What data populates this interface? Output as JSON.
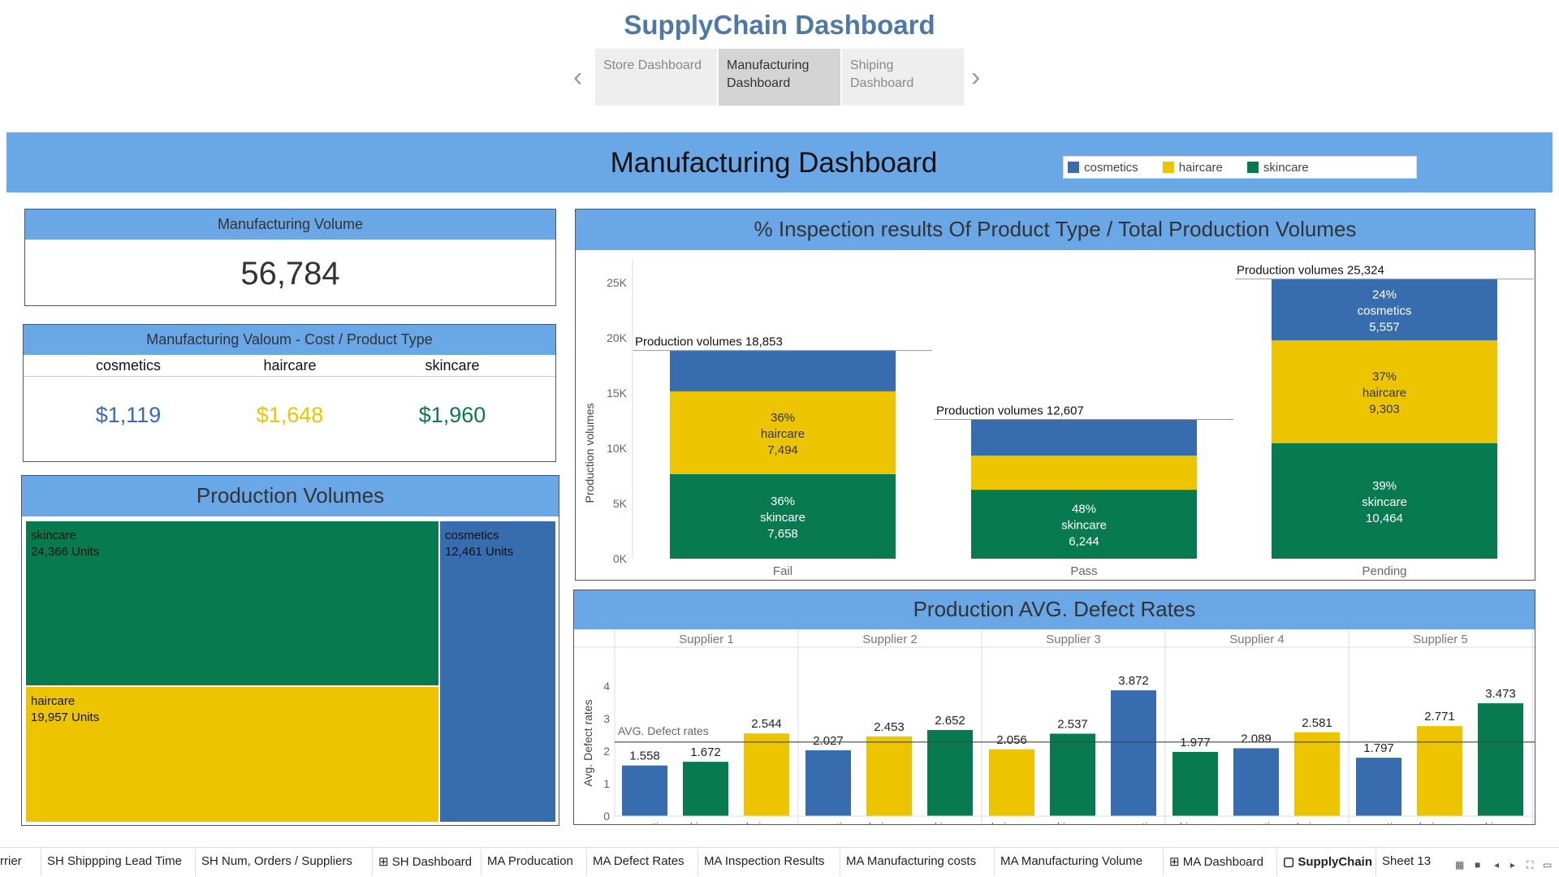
{
  "app": {
    "title": "SupplyChain Dashboard",
    "prev_label": "‹",
    "next_label": "›",
    "story_tabs": [
      {
        "label": "Store Dashboard",
        "active": false
      },
      {
        "label": "Manufacturing Dashboard",
        "active": true
      },
      {
        "label": "Shiping Dashboard",
        "active": false
      }
    ]
  },
  "banner": {
    "title": "Manufacturing Dashboard",
    "legend": [
      {
        "label": "cosmetics",
        "color": "#376daf"
      },
      {
        "label": "haircare",
        "color": "#ecc500"
      },
      {
        "label": "skincare",
        "color": "#087a50"
      }
    ]
  },
  "colors": {
    "cosmetics": "#376daf",
    "haircare": "#ecc500",
    "skincare": "#087a50",
    "header": "#6aa7e6"
  },
  "manufacturing_volume": {
    "title": "Manufacturing Volume",
    "value": "56,784"
  },
  "manufacturing_cost": {
    "title": "Manufacturing Valoum - Cost / Product Type",
    "items": [
      {
        "label": "cosmetics",
        "value": "$1,119",
        "color": "#376daf"
      },
      {
        "label": "haircare",
        "value": "$1,648",
        "color": "#ecc500"
      },
      {
        "label": "skincare",
        "value": "$1,960",
        "color": "#087a50"
      }
    ]
  },
  "production_volumes": {
    "title": "Production Volumes",
    "cells": [
      {
        "name": "skincare",
        "label": "24,366 Units",
        "value": 24366
      },
      {
        "name": "haircare",
        "label": "19,957 Units",
        "value": 19957
      },
      {
        "name": "cosmetics",
        "label": "12,461 Units",
        "value": 12461
      }
    ]
  },
  "chart_data": [
    {
      "type": "bar",
      "stacked": true,
      "title": "% Inspection results Of Product Type  / Total Production Volumes",
      "ylabel": "Production volumes",
      "ylim": [
        0,
        26000
      ],
      "yticks": [
        "0K",
        "5K",
        "10K",
        "15K",
        "20K",
        "25K"
      ],
      "ytick_values": [
        0,
        5000,
        10000,
        15000,
        20000,
        25000
      ],
      "categories": [
        "Fail",
        "Pass",
        "Pending"
      ],
      "total_prefix": "Production volumes",
      "totals": [
        "18,853",
        "12,607",
        "25,324"
      ],
      "total_values": [
        18853,
        12607,
        25324
      ],
      "series": [
        {
          "name": "skincare",
          "values": [
            7658,
            6244,
            10464
          ],
          "pct": [
            "36%",
            "48%",
            "39%"
          ],
          "labels": [
            "7,658",
            "6,244",
            "10,464"
          ],
          "show": [
            true,
            true,
            true
          ]
        },
        {
          "name": "haircare",
          "values": [
            7494,
            3095,
            9303
          ],
          "pct": [
            "36%",
            "",
            "37%"
          ],
          "labels": [
            "7,494",
            "",
            "9,303"
          ],
          "show": [
            true,
            false,
            true
          ]
        },
        {
          "name": "cosmetics",
          "values": [
            3701,
            3268,
            5557
          ],
          "pct": [
            "",
            "",
            "24%"
          ],
          "labels": [
            "",
            "",
            "5,557"
          ],
          "show": [
            false,
            false,
            true
          ]
        }
      ],
      "grid": false
    },
    {
      "type": "bar",
      "title": "Production AVG. Defect Rates",
      "ylabel": "Avg. Defect rates",
      "ylim": [
        0,
        4.25
      ],
      "yticks": [
        "0",
        "1",
        "2",
        "3",
        "4"
      ],
      "ytick_values": [
        0,
        1,
        2,
        3,
        4
      ],
      "reference_line": {
        "label": "AVG. Defect rates",
        "value": 2.28
      },
      "groups": [
        {
          "name": "Supplier 1",
          "bars": [
            {
              "category": "cosmetics",
              "value": 1.558,
              "label": "1.558"
            },
            {
              "category": "skincare",
              "value": 1.672,
              "label": "1.672"
            },
            {
              "category": "haircare",
              "value": 2.544,
              "label": "2.544"
            }
          ]
        },
        {
          "name": "Supplier 2",
          "bars": [
            {
              "category": "cosmetics",
              "value": 2.027,
              "label": "2.027"
            },
            {
              "category": "haircare",
              "value": 2.453,
              "label": "2.453"
            },
            {
              "category": "skincare",
              "value": 2.652,
              "label": "2.652"
            }
          ]
        },
        {
          "name": "Supplier 3",
          "bars": [
            {
              "category": "haircare",
              "value": 2.056,
              "label": "2.056"
            },
            {
              "category": "skincare",
              "value": 2.537,
              "label": "2.537"
            },
            {
              "category": "cosmetics",
              "value": 3.872,
              "label": "3.872"
            }
          ]
        },
        {
          "name": "Supplier 4",
          "bars": [
            {
              "category": "skincare",
              "value": 1.977,
              "label": "1.977"
            },
            {
              "category": "cosmetics",
              "value": 2.089,
              "label": "2.089"
            },
            {
              "category": "haircare",
              "value": 2.581,
              "label": "2.581"
            }
          ]
        },
        {
          "name": "Supplier 5",
          "bars": [
            {
              "category": "cosmetics",
              "value": 1.797,
              "label": "1.797"
            },
            {
              "category": "haircare",
              "value": 2.771,
              "label": "2.771"
            },
            {
              "category": "skincare",
              "value": 3.473,
              "label": "3.473"
            }
          ]
        }
      ],
      "grid": false
    }
  ],
  "sheet_tabs": [
    {
      "label": "rrier",
      "icon": "",
      "active": false
    },
    {
      "label": "SH Shippping Lead Time",
      "icon": "",
      "active": false
    },
    {
      "label": "SH Num, Orders / Suppliers",
      "icon": "",
      "active": false
    },
    {
      "label": "SH Dashboard",
      "icon": "⊞",
      "active": false
    },
    {
      "label": "MA Producation",
      "icon": "",
      "active": false
    },
    {
      "label": "MA Defect Rates",
      "icon": "",
      "active": false
    },
    {
      "label": "MA Inspection Results",
      "icon": "",
      "active": false
    },
    {
      "label": "MA Manufacturing costs",
      "icon": "",
      "active": false
    },
    {
      "label": "MA Manufacturing Volume",
      "icon": "",
      "active": false
    },
    {
      "label": "MA Dashboard",
      "icon": "⊞",
      "active": false
    },
    {
      "label": "SupplyChain",
      "icon": "▢",
      "active": true
    },
    {
      "label": "Sheet 13",
      "icon": "",
      "active": false
    }
  ],
  "sheet_controls": [
    "grid-view-icon",
    "list-view-icon",
    "prev-sheet-icon",
    "next-sheet-icon",
    "fullscreen-icon",
    "present-icon"
  ]
}
